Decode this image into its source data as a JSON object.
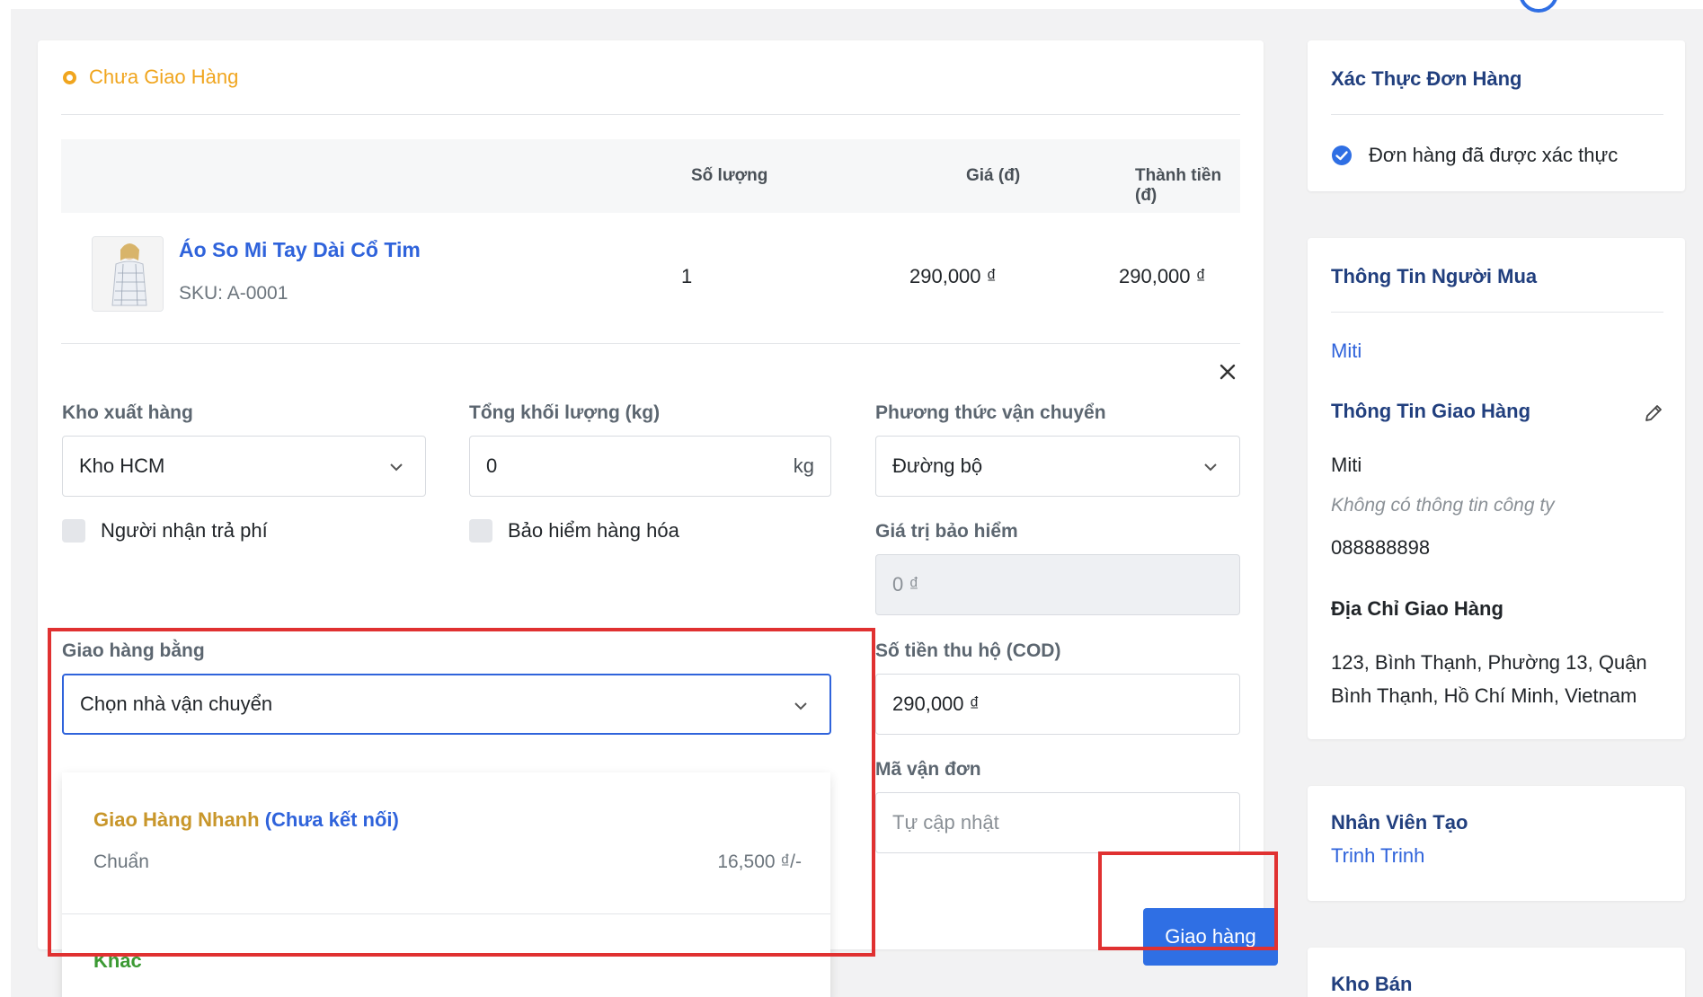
{
  "order": {
    "status": "Chưa Giao Hàng",
    "table": {
      "headers": {
        "quantity": "Số lượng",
        "price": "Giá (đ)",
        "total": "Thành tiền (đ)"
      },
      "rows": [
        {
          "name": "Áo So Mi Tay Dài Cổ Tim",
          "sku": "SKU: A-0001",
          "quantity": "1",
          "price": "290,000 ₫",
          "total": "290,000 ₫"
        }
      ]
    }
  },
  "shipping_form": {
    "warehouse": {
      "label": "Kho xuất hàng",
      "value": "Kho HCM"
    },
    "weight": {
      "label": "Tổng khối lượng (kg)",
      "value": "0",
      "unit": "kg"
    },
    "method": {
      "label": "Phương thức vận chuyển",
      "value": "Đường bộ"
    },
    "receiver_pays": {
      "label": "Người nhận trả phí",
      "checked": false
    },
    "insurance": {
      "label": "Bảo hiểm hàng hóa",
      "checked": false
    },
    "insurance_value": {
      "label": "Giá trị bảo hiểm",
      "placeholder": "0 ₫"
    },
    "carrier": {
      "label": "Giao hàng bằng",
      "value": "Chọn nhà vận chuyển",
      "options": [
        {
          "name": "Giao Hàng Nhanh",
          "note": "(Chưa kết nối)",
          "service": "Chuẩn",
          "price": "16,500 ₫/-"
        },
        {
          "name": "Khác"
        }
      ]
    },
    "cod": {
      "label": "Số tiền thu hộ (COD)",
      "value": "290,000 ₫"
    },
    "tracking": {
      "label": "Mã vận đơn",
      "placeholder": "Tự cập nhật"
    },
    "submit_label": "Giao hàng"
  },
  "sidebar": {
    "verification": {
      "title": "Xác Thực Đơn Hàng",
      "status": "Đơn hàng đã được xác thực"
    },
    "buyer": {
      "title": "Thông Tin Người Mua",
      "name": "Miti"
    },
    "delivery": {
      "title": "Thông Tin Giao Hàng",
      "name": "Miti",
      "company": "Không có thông tin công ty",
      "phone": "088888898",
      "address_title": "Địa Chỉ Giao Hàng",
      "address_line1": "123, Bình Thạnh, Phường 13, Quận",
      "address_line2": "Bình Thạnh, Hồ Chí Minh, Vietnam"
    },
    "creator": {
      "title": "Nhân Viên Tạo",
      "name": "Trinh Trinh"
    },
    "sales_warehouse": {
      "title": "Kho Bán"
    }
  },
  "colors": {
    "primary": "#2f6fe4",
    "status_pending": "#f0a51e",
    "highlight_box": "#e03131",
    "carrier_name": "#c8962a",
    "other_option": "#3c9a34"
  },
  "icons": [
    "status-dot-icon",
    "close-icon",
    "chevron-down-icon",
    "verified-check-icon",
    "edit-pencil-icon"
  ]
}
